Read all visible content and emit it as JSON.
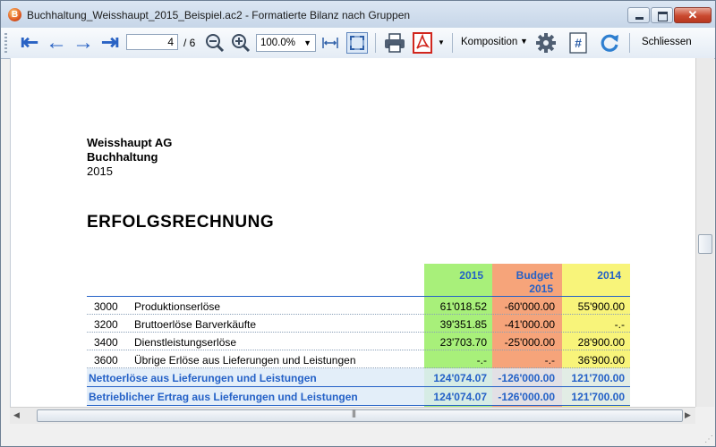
{
  "window": {
    "app_icon_letter": "B",
    "title": "Buchhaltung_Weisshaupt_2015_Beispiel.ac2 - Formatierte Bilanz nach Gruppen",
    "close_glyph": "✕"
  },
  "toolbar": {
    "arrow_first": "⇤",
    "arrow_prev": "←",
    "arrow_next": "→",
    "arrow_last": "⇥",
    "page_current": "4",
    "page_total": "/ 6",
    "zoom_value": "100.0%",
    "komposition_label": "Komposition",
    "schliessen_label": "Schliessen",
    "numbering_glyph": "#"
  },
  "report": {
    "company": "Weisshaupt AG",
    "department": "Buchhaltung",
    "year": "2015",
    "title": "ERFOLGSRECHNUNG",
    "columns": {
      "col1": "2015",
      "col2_line1": "Budget",
      "col2_line2": "2015",
      "col3": "2014"
    },
    "rows": [
      {
        "account": "3000",
        "description": "Produktionserlöse",
        "v2015": "61'018.52",
        "budget": "-60'000.00",
        "v2014": "55'900.00"
      },
      {
        "account": "3200",
        "description": "Bruttoerlöse Barverkäufte",
        "v2015": "39'351.85",
        "budget": "-41'000.00",
        "v2014": "-.-"
      },
      {
        "account": "3400",
        "description": "Dienstleistungserlöse",
        "v2015": "23'703.70",
        "budget": "-25'000.00",
        "v2014": "28'900.00"
      },
      {
        "account": "3600",
        "description": "Übrige Erlöse aus Lieferungen und Leistungen",
        "v2015": "-.-",
        "budget": "-.-",
        "v2014": "36'900.00"
      }
    ],
    "totals": [
      {
        "description": "Nettoerlöse aus Lieferungen und Leistungen",
        "v2015": "124'074.07",
        "budget": "-126'000.00",
        "v2014": "121'700.00"
      },
      {
        "description": "Betrieblicher Ertrag aus Lieferungen und Leistungen",
        "v2015": "124'074.07",
        "budget": "-126'000.00",
        "v2014": "121'700.00"
      }
    ]
  },
  "colors": {
    "accent": "#2461c7",
    "col_2015": "#a8f07a",
    "col_budget": "#f6a47a",
    "col_2014": "#f8f47a"
  }
}
